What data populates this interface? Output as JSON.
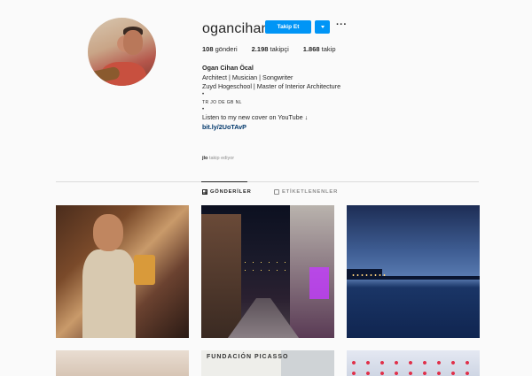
{
  "profile": {
    "username": "ogancihan",
    "follow_label": "Takip Et",
    "more_label": "···",
    "stats": [
      {
        "count": "108",
        "label": "gönderi"
      },
      {
        "count": "2.198",
        "label": "takipçi"
      },
      {
        "count": "1.868",
        "label": "takip"
      }
    ],
    "bio": {
      "name": "Ogan Cihan Öcal",
      "line1": "Architect | Musician | Songwriter",
      "line2": "Zuyd Hogeschool | Master of Interior Architecture",
      "flags": "TR JO DE GB NL",
      "cta": "Listen to my new cover on YouTube ↓",
      "link": "bit.ly/2UoTAvP"
    },
    "followed_by_user": "jlo",
    "followed_by_text": "takip ediyor"
  },
  "tabs": [
    {
      "label": "GÖNDERİLER",
      "icon": "grid-icon"
    },
    {
      "label": "ETİKETLENENLER",
      "icon": "tag-icon"
    }
  ],
  "posts": {
    "p5_sign": "FUNDACIÓN PICASSO"
  },
  "colors": {
    "accent": "#0095f6",
    "text": "#262626",
    "muted": "#8e8e8e",
    "link": "#00376b"
  }
}
